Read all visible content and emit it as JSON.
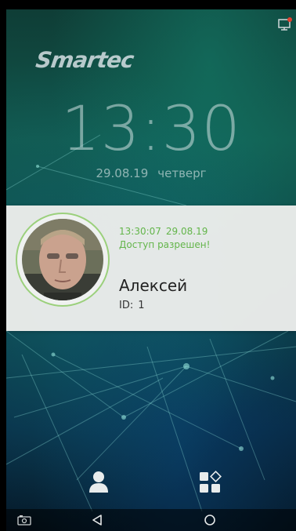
{
  "brand": {
    "logo_text": "Smartec"
  },
  "clock": {
    "time": "13:30",
    "date": "29.08.19",
    "weekday": "четверг"
  },
  "recognition": {
    "time": "13:30:07",
    "date": "29.08.19",
    "status": "Доступ разрешен!",
    "name": "Алексей",
    "id_label": "ID:",
    "id_value": "1"
  },
  "icons": {
    "network_status": "monitor-alert-icon",
    "user_button": "user-icon",
    "apps_button": "apps-grid-icon",
    "nav_camera": "screenshot-camera-icon",
    "nav_back": "back-triangle-icon",
    "nav_home": "home-circle-icon"
  },
  "colors": {
    "accent_green": "#63b54a",
    "ring_green": "#9bd07c",
    "card_bg": "#f0f0ee",
    "status_icon_red": "#e04030"
  }
}
